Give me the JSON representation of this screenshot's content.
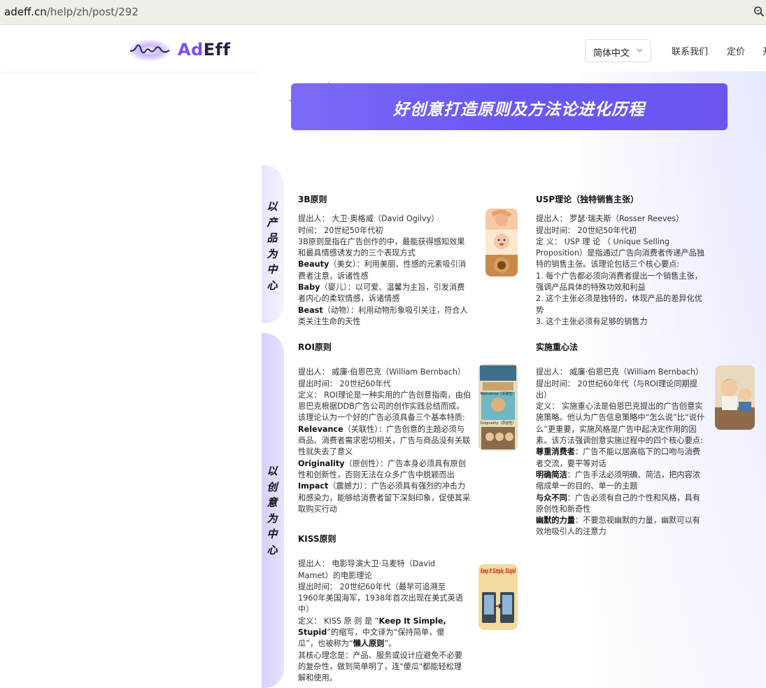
{
  "browser": {
    "url_host": "adeff.cn",
    "url_path": "/help/zh/post/292"
  },
  "header": {
    "logo_prefix": "Ad",
    "logo_suffix": "Eff",
    "language": "简体中文",
    "nav": {
      "contact": "联系我们",
      "pricing": "定价",
      "more": "开"
    }
  },
  "banner": {
    "title": "好创意打造原则及方法论进化历程"
  },
  "side_tabs": {
    "product": "以产品为中心",
    "creative": "以创意为中心"
  },
  "cards": {
    "b3": {
      "title": "3B原则",
      "lines": [
        "提出人： 大卫·奥格威（David Ogilvy）",
        "时间： 20世纪50年代初",
        "3B原则是指在广告创作的中，最能获得感知效果和最具情感诱发力的三个表现方式"
      ],
      "items": [
        {
          "term": "Beauty",
          "text": "（美女）：利用美丽、性感的元素吸引消费者注意，诉诸性感"
        },
        {
          "term": "Baby",
          "text": "（婴儿）：以可爱、温馨为主旨，引发消费者内心的柔软情感，诉诸情感"
        },
        {
          "term": "Beast",
          "text": "（动物）：利用动物形象吸引关注，符合人类关注生命的天性"
        }
      ]
    },
    "usp": {
      "title": "USP理论（独特销售主张）",
      "lines": [
        "提出人： 罗瑟·瑞夫斯（Rosser Reeves）",
        "提出时间： 20世纪50年代初",
        "定 义： USP 理 论 （ Unique Selling Proposition）是指通过广告向消费者传递产品独特的销售主张。该理论包括三个核心要点:",
        "1. 每个广告都必须向消费者提出一个销售主张，强调产品具体的特殊功效和利益",
        "2. 这个主张必须是独特的，体现产品的差异化优势",
        "3. 这个主张必须有足够的销售力"
      ]
    },
    "roi": {
      "title": "ROI原则",
      "lines": [
        "提出人： 威廉·伯恩巴克（William Bernbach）",
        "提出时间： 20世纪60年代",
        "定义： ROI理论是一种实用的广告创意指南，由伯恩巴克根据DDB广告公司的创作实践总结而成。该理论认为一个好的广告必须具备三个基本特质:"
      ],
      "items": [
        {
          "term": "Relevance",
          "text": "（关联性）：广告创意的主题必须与商品、消费者需求密切相关，广告与商品没有关联性就失去了意义"
        },
        {
          "term": "Originality",
          "text": "（原创性）：广告本身必须具有原创性和创新性，否则无法在众多广告中脱颖而出"
        },
        {
          "term": "Impact",
          "text": "（震撼力）：广告必须具有强烈的冲击力和感染力，能够给消费者留下深刻印象，促使其采取购买行动"
        }
      ],
      "thumb_labels": [
        "Relevance（关联性）",
        "Originality（原创性）"
      ]
    },
    "exec": {
      "title": "实施重心法",
      "lines": [
        "提出人： 威廉·伯恩巴克（William Bernbach）",
        "提出时间： 20世纪60年代（与ROI理论同期提出）",
        "定义： 实施重心法是伯恩巴克提出的广告创意实施策略。他认为广告信息策略中“怎么说”比“说什么”更重要，实施风格是广告中起决定作用的因素。该方法强调创意实施过程中的四个核心要点:"
      ],
      "items": [
        {
          "term": "尊重消费者",
          "text": "：广告不能以居高临下的口吻与消费者交流，要平等对话"
        },
        {
          "term": "明确简洁",
          "text": "：广告手法必须明确、简洁，把内容浓缩成单一的目的、单一的主题"
        },
        {
          "term": "与众不同",
          "text": "：广告必须有自己的个性和风格，具有原创性和新奇性"
        },
        {
          "term": "幽默的力量",
          "text": "：不要忽视幽默的力量，幽默可以有效地吸引人的注意力"
        }
      ]
    },
    "kiss": {
      "title": "KISS原则",
      "line1": "提出人： 电影导演大卫·马麦特（David Mamet）的电影理论",
      "line2": "提出时间： 20世纪60年代（最早可追溯至1960年美国海军，1938年首次出现在美式英语中）",
      "def_prefix": "定义： KISS 原 则 是 “",
      "def_term": "Keep It Simple, Stupid",
      "def_mid": "”的缩写，中文译为“保持简单，傻瓜”，也被称为“",
      "def_term2": "懒人原则",
      "def_end": "”。",
      "line4": "其核心理念是：产品、服务或设计应避免不必要的复杂性，做到简单明了，连\"傻瓜\"都能轻松理解和使用。",
      "thumb_text": "Keep It Simple, Stupid"
    }
  },
  "colors": {
    "brand_purple": "#7b4ff5",
    "banner_start": "#7c6af7",
    "banner_end": "#6a55f0"
  }
}
